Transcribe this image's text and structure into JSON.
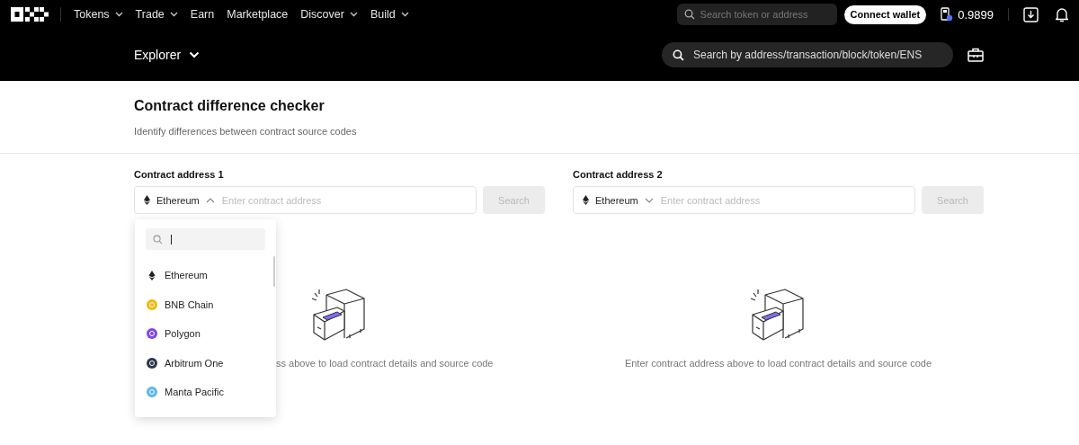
{
  "top_nav": {
    "items": [
      {
        "label": "Tokens",
        "has_menu": true
      },
      {
        "label": "Trade",
        "has_menu": true
      },
      {
        "label": "Earn",
        "has_menu": false
      },
      {
        "label": "Marketplace",
        "has_menu": false
      },
      {
        "label": "Discover",
        "has_menu": true
      },
      {
        "label": "Build",
        "has_menu": true
      }
    ],
    "search": {
      "placeholder": "Search token or address"
    },
    "connect_button": "Connect wallet",
    "price": "0.9899"
  },
  "explorer_bar": {
    "title": "Explorer",
    "search": {
      "placeholder": "Search by address/transaction/block/token/ENS"
    }
  },
  "page": {
    "title": "Contract difference checker",
    "subtitle": "Identify differences between contract source codes"
  },
  "panels": [
    {
      "label": "Contract address 1",
      "chain": "Ethereum",
      "expanded": true,
      "placeholder": "Enter contract address",
      "button": "Search",
      "button_disabled": true,
      "empty_text": "ss above to load contract details and source code"
    },
    {
      "label": "Contract address 2",
      "chain": "Ethereum",
      "expanded": false,
      "placeholder": "Enter contract address",
      "button": "Search",
      "button_disabled": true,
      "empty_text": "Enter contract address above to load contract details and source code"
    }
  ],
  "chain_dropdown": {
    "items": [
      {
        "name": "Ethereum",
        "kind": "eth",
        "color": "#222222"
      },
      {
        "name": "BNB Chain",
        "kind": "coin",
        "color": "#f0b90b"
      },
      {
        "name": "Polygon",
        "kind": "coin",
        "color": "#8247e5"
      },
      {
        "name": "Arbitrum One",
        "kind": "coin",
        "color": "#2d374b"
      },
      {
        "name": "Manta Pacific",
        "kind": "coin",
        "color": "#5fb6e8"
      }
    ]
  }
}
